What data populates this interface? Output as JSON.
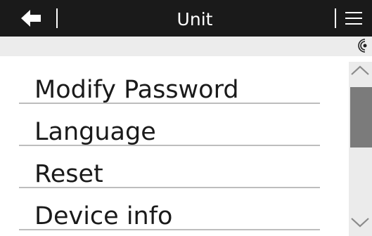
{
  "header": {
    "title": "Unit",
    "back_icon": "arrow-left-icon",
    "menu_icon": "hamburger-menu-icon"
  },
  "status_bar": {
    "icon": "signal-icon"
  },
  "menu": {
    "items": [
      {
        "label": "Modify Password"
      },
      {
        "label": "Language"
      },
      {
        "label": "Reset"
      },
      {
        "label": "Device info"
      }
    ]
  },
  "scrollbar": {
    "up_icon": "chevron-up-icon",
    "down_icon": "chevron-down-icon"
  },
  "colors": {
    "header_bg": "#1a1a1a",
    "text": "#1a1a1a",
    "status_bar_bg": "#ececec",
    "scroll_thumb": "#7b7b7b"
  }
}
